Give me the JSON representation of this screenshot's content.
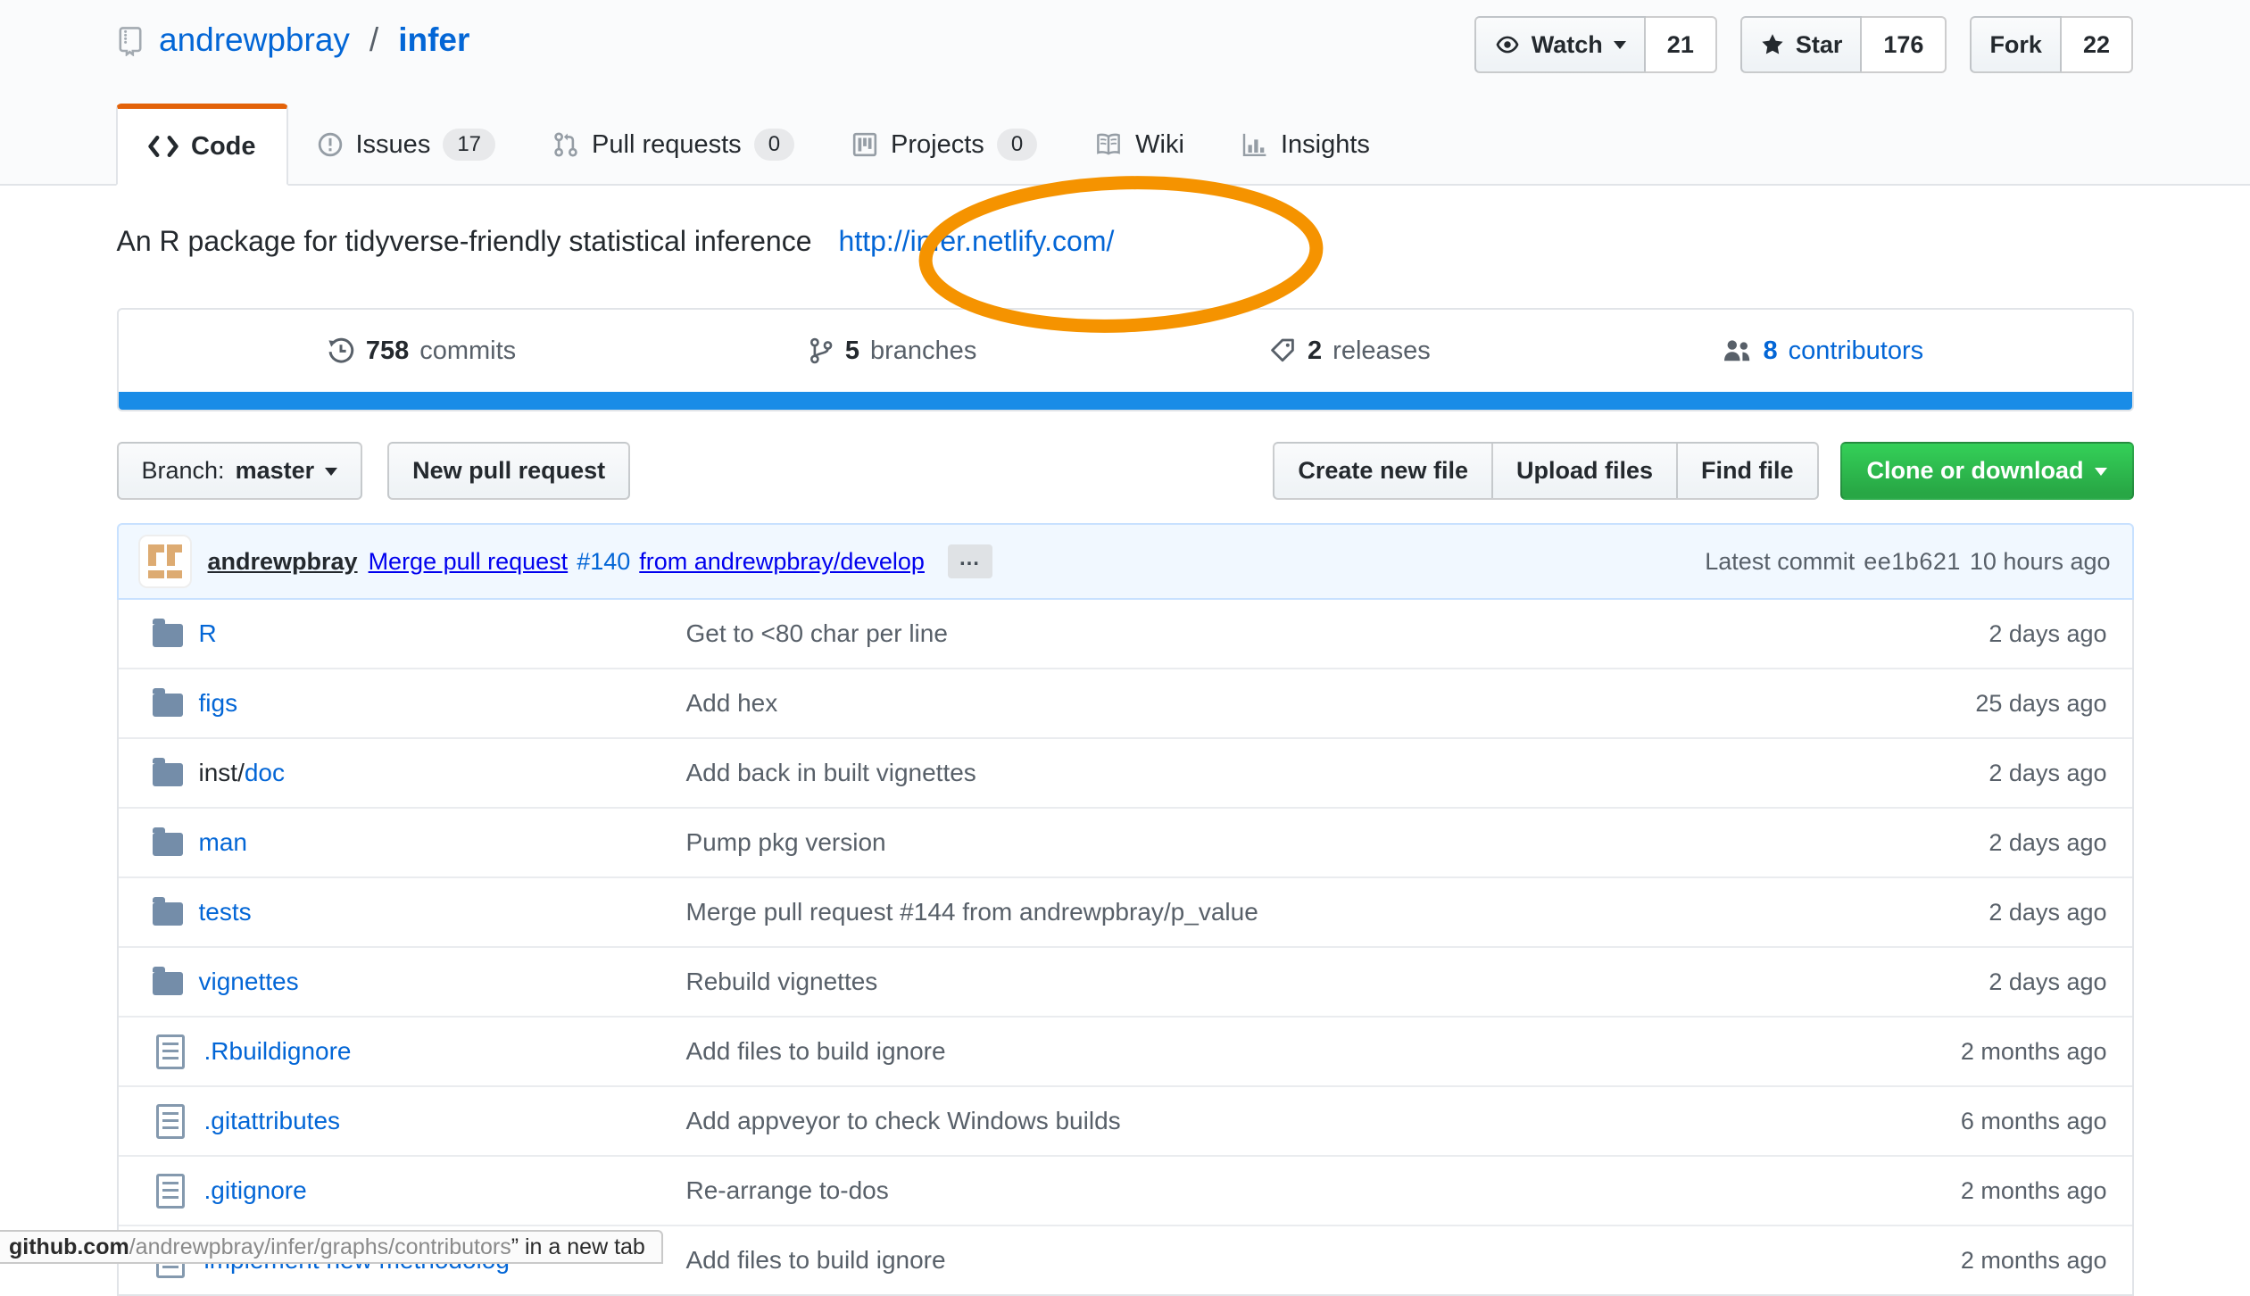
{
  "colors": {
    "link_blue": "#0366d6",
    "tab_accent_orange": "#e36209",
    "annotation_orange": "#F59300",
    "language_bar_blue": "#198CE7",
    "clone_button_green": "#28a745",
    "commit_bar_bg": "#f1f8ff"
  },
  "header": {
    "repo_owner": "andrewpbray",
    "separator": "/",
    "repo_name": "infer",
    "watch": {
      "label": "Watch",
      "count": "21"
    },
    "star": {
      "label": "Star",
      "count": "176"
    },
    "fork": {
      "label": "Fork",
      "count": "22"
    }
  },
  "tabs": [
    {
      "label": "Code"
    },
    {
      "label": "Issues",
      "count": "17"
    },
    {
      "label": "Pull requests",
      "count": "0"
    },
    {
      "label": "Projects",
      "count": "0"
    },
    {
      "label": "Wiki"
    },
    {
      "label": "Insights"
    }
  ],
  "description": {
    "text": "An R package for tidyverse-friendly statistical inference",
    "link": "http://infer.netlify.com/"
  },
  "stats": {
    "items": [
      {
        "number": "758",
        "label": "commits"
      },
      {
        "number": "5",
        "label": "branches"
      },
      {
        "number": "2",
        "label": "releases"
      },
      {
        "number": "8",
        "label": "contributors"
      }
    ]
  },
  "language_bar": {
    "segments": [
      {
        "color": "#198CE7",
        "width_percent": 100
      }
    ]
  },
  "toolbar": {
    "branch_label": "Branch:",
    "branch_name": "master",
    "new_pull_request": "New pull request",
    "create_new_file": "Create new file",
    "upload_files": "Upload files",
    "find_file": "Find file",
    "clone_or_download": "Clone or download"
  },
  "commit_bar": {
    "author": "andrewpbray",
    "message": "Merge pull request",
    "pr_link": "#140",
    "message_tail": "from andrewpbray/develop",
    "expander": "…",
    "latest_label": "Latest commit",
    "sha": "ee1b621",
    "time": "10 hours ago"
  },
  "files": [
    {
      "type": "folder",
      "name": "R",
      "message": "Get to <80 char per line",
      "date": "2 days ago"
    },
    {
      "type": "folder",
      "name": "figs",
      "message": "Add hex",
      "date": "25 days ago"
    },
    {
      "type": "folder",
      "name_prefix": "inst/",
      "name": "doc",
      "message": "Add back in built vignettes",
      "date": "2 days ago"
    },
    {
      "type": "folder",
      "name": "man",
      "message": "Pump pkg version",
      "date": "2 days ago"
    },
    {
      "type": "folder",
      "name": "tests",
      "message": "Merge pull request #144 from andrewpbray/p_value",
      "date": "2 days ago"
    },
    {
      "type": "folder",
      "name": "vignettes",
      "message": "Rebuild vignettes",
      "date": "2 days ago"
    },
    {
      "type": "file",
      "name": ".Rbuildignore",
      "message": "Add files to build ignore",
      "date": "2 months ago"
    },
    {
      "type": "file",
      "name": ".gitattributes",
      "message": "Add appveyor to check Windows builds",
      "date": "6 months ago"
    },
    {
      "type": "file",
      "name": ".gitignore",
      "message": "Re-arrange to-dos",
      "date": "2 months ago"
    },
    {
      "type": "file",
      "name": "implement new methodolog",
      "message": "Add files to build ignore",
      "date": "2 months ago",
      "partially_hidden": true
    }
  ],
  "status_bubble": {
    "domain": "github.com",
    "path": "/andrewpbray/infer/graphs/contributors",
    "suffix": "” in a new tab"
  }
}
